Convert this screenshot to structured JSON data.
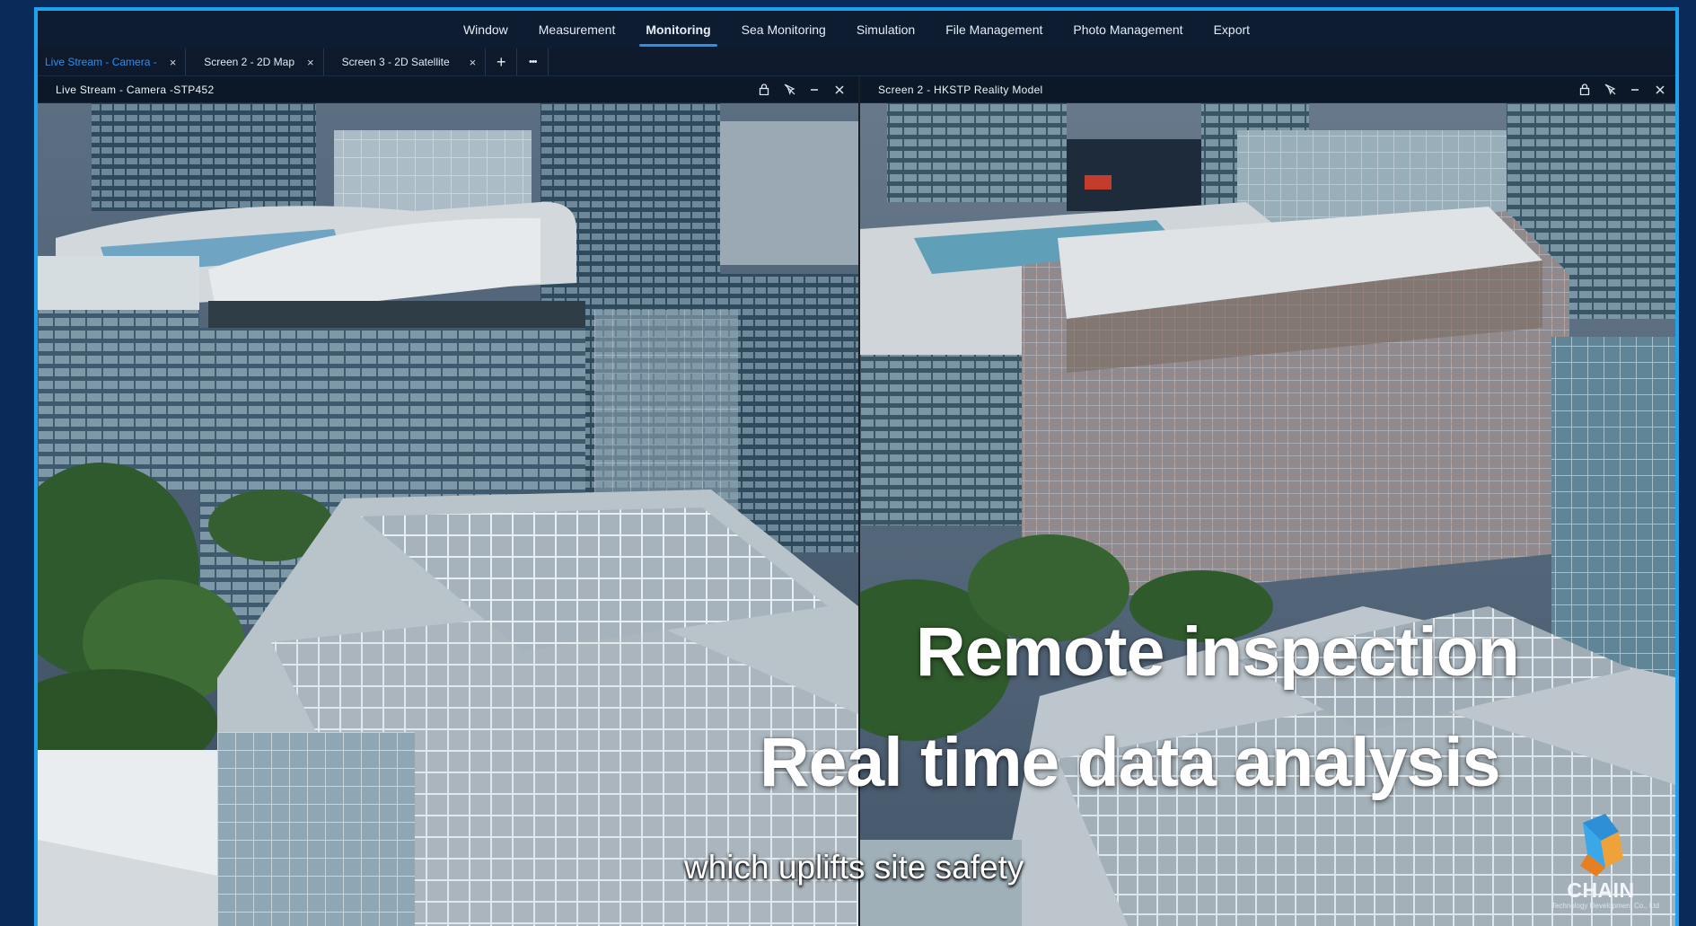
{
  "menubar": {
    "items": [
      "Window",
      "Measurement",
      "Monitoring",
      "Sea Monitoring",
      "Simulation",
      "File Management",
      "Photo Management",
      "Export"
    ],
    "active": "Monitoring"
  },
  "tabs": [
    {
      "label": "Live Stream - Camera -",
      "active": true
    },
    {
      "label": "Screen 2 - 2D Map",
      "active": false
    },
    {
      "label": "Screen 3 - 2D Satellite",
      "active": false
    }
  ],
  "tab_actions": {
    "add": "+",
    "more": "•••",
    "close": "×"
  },
  "panels": {
    "left": {
      "title": "Live Stream - Camera -STP452"
    },
    "right": {
      "title": "Screen 2 - HKSTP Reality Model"
    }
  },
  "overlay": {
    "line1": "Remote inspection",
    "line2": "Real time data analysis",
    "subtitle": "which uplifts site safety"
  },
  "logo": {
    "name": "CHAIN",
    "sub": "Technology Development Co., Ltd"
  },
  "colors": {
    "accent": "#1ea2ee",
    "active_tab": "#2e8ef0",
    "frame_bg": "#0a2a5a"
  }
}
